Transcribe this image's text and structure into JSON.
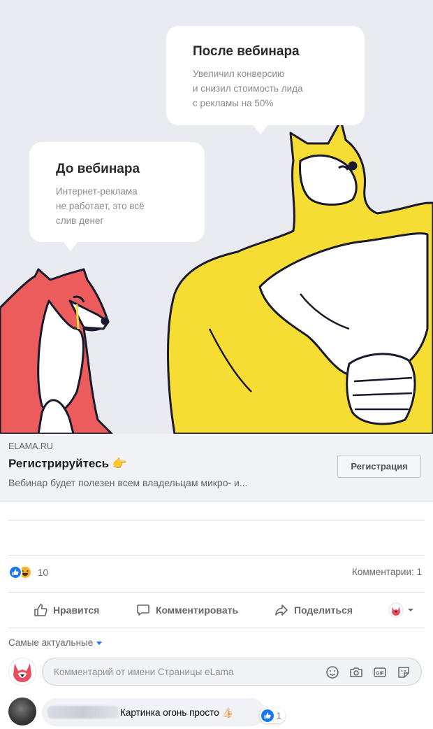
{
  "ad_image": {
    "after_bubble": {
      "title": "После вебинара",
      "lines": [
        "Увеличил конверсию",
        "и снизил стоимость лида",
        "с рекламы на 50%"
      ]
    },
    "before_bubble": {
      "title": "До вебинара",
      "lines": [
        "Интернет-реклама",
        "не работает, это всё",
        "слив денег"
      ]
    },
    "colors": {
      "background": "#e9ebf0",
      "strong_dog": "#f6dd33",
      "weak_dog": "#ec5c5c"
    }
  },
  "link_preview": {
    "domain": "ELAMA.RU",
    "headline": "Регистрируйтесь 👉",
    "description": "Вебинар будет полезен всем владельцам микро- и...",
    "cta_label": "Регистрация"
  },
  "engagement": {
    "reaction_icons": [
      "like-icon",
      "haha-icon"
    ],
    "reaction_count": "10",
    "comments_label": "Комментарии: 1"
  },
  "actions": {
    "like": "Нравится",
    "comment": "Комментировать",
    "share": "Поделиться"
  },
  "comments": {
    "sort_label": "Самые актуальные",
    "input_placeholder": "Комментарий от имени Страницы eLama",
    "input_icons": [
      "emoji-icon",
      "camera-icon",
      "gif-icon",
      "sticker-icon"
    ],
    "items": [
      {
        "text": "Картинка огонь просто 👍🏻",
        "reaction_count": "1"
      }
    ]
  },
  "accent_color": "#1877f2"
}
